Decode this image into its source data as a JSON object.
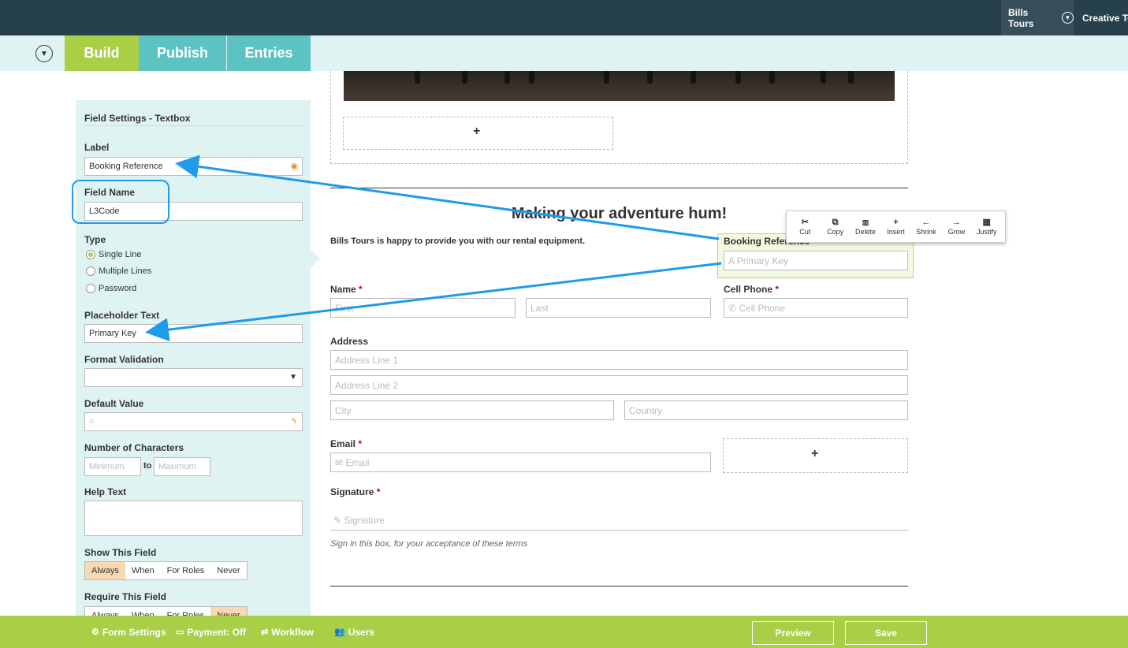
{
  "header": {
    "org_name": "Bills Tours",
    "user_name": "Creative Tec"
  },
  "tabs": {
    "build": "Build",
    "publish": "Publish",
    "entries": "Entries"
  },
  "field_settings": {
    "title": "Field Settings - Textbox",
    "label_title": "Label",
    "label_value": "Booking Reference",
    "field_name_title": "Field Name",
    "field_name_value": "L3Code",
    "type_title": "Type",
    "type_options": [
      "Single Line",
      "Multiple Lines",
      "Password"
    ],
    "type_selected": "Single Line",
    "placeholder_title": "Placeholder Text",
    "placeholder_value": "Primary Key",
    "format_title": "Format Validation",
    "format_value": "",
    "default_title": "Default Value",
    "default_value": "=",
    "chars_title": "Number of Characters",
    "chars_min_placeholder": "Minimum",
    "chars_to": "to",
    "chars_max_placeholder": "Maximum",
    "help_title": "Help Text",
    "help_value": "",
    "show_title": "Show This Field",
    "show_options": [
      "Always",
      "When",
      "For Roles",
      "Never"
    ],
    "show_selected": "Always",
    "require_title": "Require This Field",
    "require_options": [
      "Always",
      "When",
      "For Roles",
      "Never"
    ],
    "require_selected": "Never"
  },
  "form": {
    "heading": "Making your adventure hum!",
    "intro": "Bills Tours is happy to provide you with our rental equipment.",
    "booking_label": "Booking Reference",
    "booking_placeholder": "Primary Key",
    "name_label": "Name",
    "name_first_placeholder": "First",
    "name_last_placeholder": "Last",
    "cell_label": "Cell Phone",
    "cell_placeholder": "Cell Phone",
    "address_label": "Address",
    "address1_placeholder": "Address Line 1",
    "address2_placeholder": "Address Line 2",
    "city_placeholder": "City",
    "country_placeholder": "Country",
    "email_label": "Email",
    "email_placeholder": "Email",
    "signature_label": "Signature",
    "signature_placeholder": "Signature",
    "signature_note": "Sign in this box, for your acceptance of these terms",
    "required_mark": "*",
    "add_symbol": "+"
  },
  "field_toolbar": {
    "items": [
      {
        "label": "Cut",
        "icon": "scissors-icon",
        "glyph": "✂"
      },
      {
        "label": "Copy",
        "icon": "copy-icon",
        "glyph": "⧉"
      },
      {
        "label": "Delete",
        "icon": "trash-icon",
        "glyph": "🗑"
      },
      {
        "label": "Insert",
        "icon": "plus-icon",
        "glyph": "+"
      },
      {
        "label": "Shrink",
        "icon": "arrow-left-icon",
        "glyph": "←"
      },
      {
        "label": "Grow",
        "icon": "arrow-right-icon",
        "glyph": "→"
      },
      {
        "label": "Justify",
        "icon": "grid-icon",
        "glyph": "▦"
      }
    ]
  },
  "footer": {
    "form_settings": "Form Settings",
    "payment": "Payment: Off",
    "workflow": "Workflow",
    "users": "Users",
    "preview": "Preview",
    "save": "Save"
  },
  "colors": {
    "topbar": "#26404c",
    "accent_green": "#a9cf46",
    "accent_teal": "#5cc3c2",
    "panel_bg": "#dff3f3",
    "annotation_blue": "#1e9bea"
  }
}
